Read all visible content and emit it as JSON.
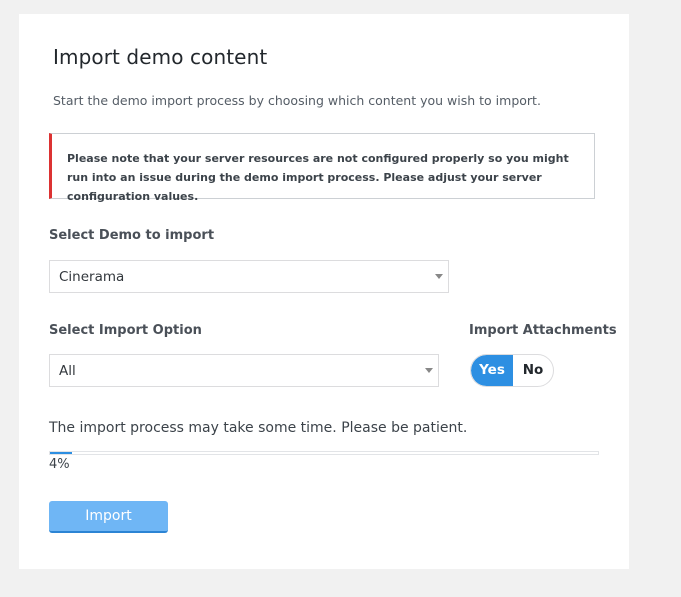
{
  "page": {
    "title": "Import demo content",
    "subtitle": "Start the demo import process by choosing which content you wish to import."
  },
  "notice": {
    "text": "Please note that your server resources are not configured properly so you might run into an issue during the demo import process. Please adjust your server configuration values.",
    "accent_color": "#dc3232"
  },
  "demo_select": {
    "label": "Select Demo to import",
    "selected": "Cinerama"
  },
  "option_select": {
    "label": "Select Import Option",
    "selected": "All"
  },
  "attachments": {
    "label": "Import Attachments",
    "yes_label": "Yes",
    "no_label": "No",
    "selected": "Yes",
    "active_color": "#2d8fe2"
  },
  "progress": {
    "message": "The import process may take some time. Please be patient.",
    "percent": 4,
    "percent_label": "4%"
  },
  "import_button": {
    "label": "Import",
    "color": "#6fb6f5"
  }
}
